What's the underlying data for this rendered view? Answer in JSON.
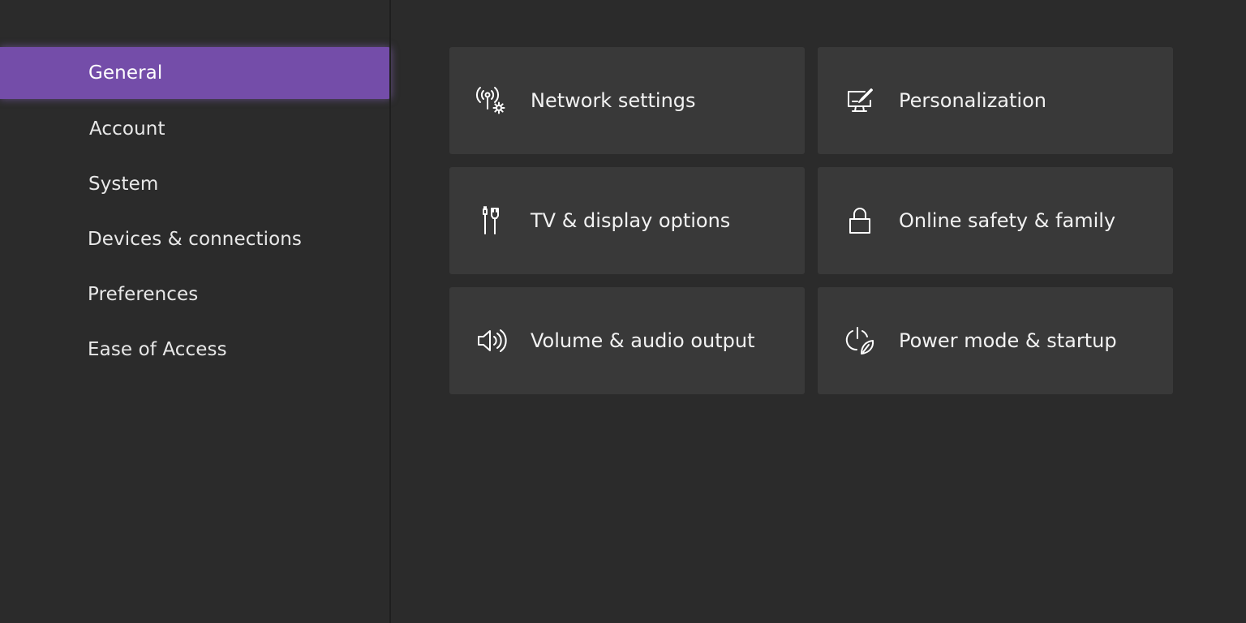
{
  "sidebar": {
    "items": [
      {
        "label": "General",
        "selected": true
      },
      {
        "label": "Account",
        "selected": false
      },
      {
        "label": "System",
        "selected": false
      },
      {
        "label": "Devices & connections",
        "selected": false
      },
      {
        "label": "Preferences",
        "selected": false
      },
      {
        "label": "Ease of Access",
        "selected": false
      }
    ],
    "selected_color": "#744da9"
  },
  "tiles": [
    {
      "label": "Network settings",
      "icon": "network-gear-icon"
    },
    {
      "label": "Personalization",
      "icon": "monitor-brush-icon"
    },
    {
      "label": "TV & display options",
      "icon": "hdmi-cable-icon"
    },
    {
      "label": "Online safety & family",
      "icon": "lock-icon"
    },
    {
      "label": "Volume & audio output",
      "icon": "speaker-icon"
    },
    {
      "label": "Power mode & startup",
      "icon": "power-leaf-icon"
    }
  ],
  "colors": {
    "background": "#2b2b2b",
    "tile": "#393939",
    "accent": "#744da9"
  }
}
